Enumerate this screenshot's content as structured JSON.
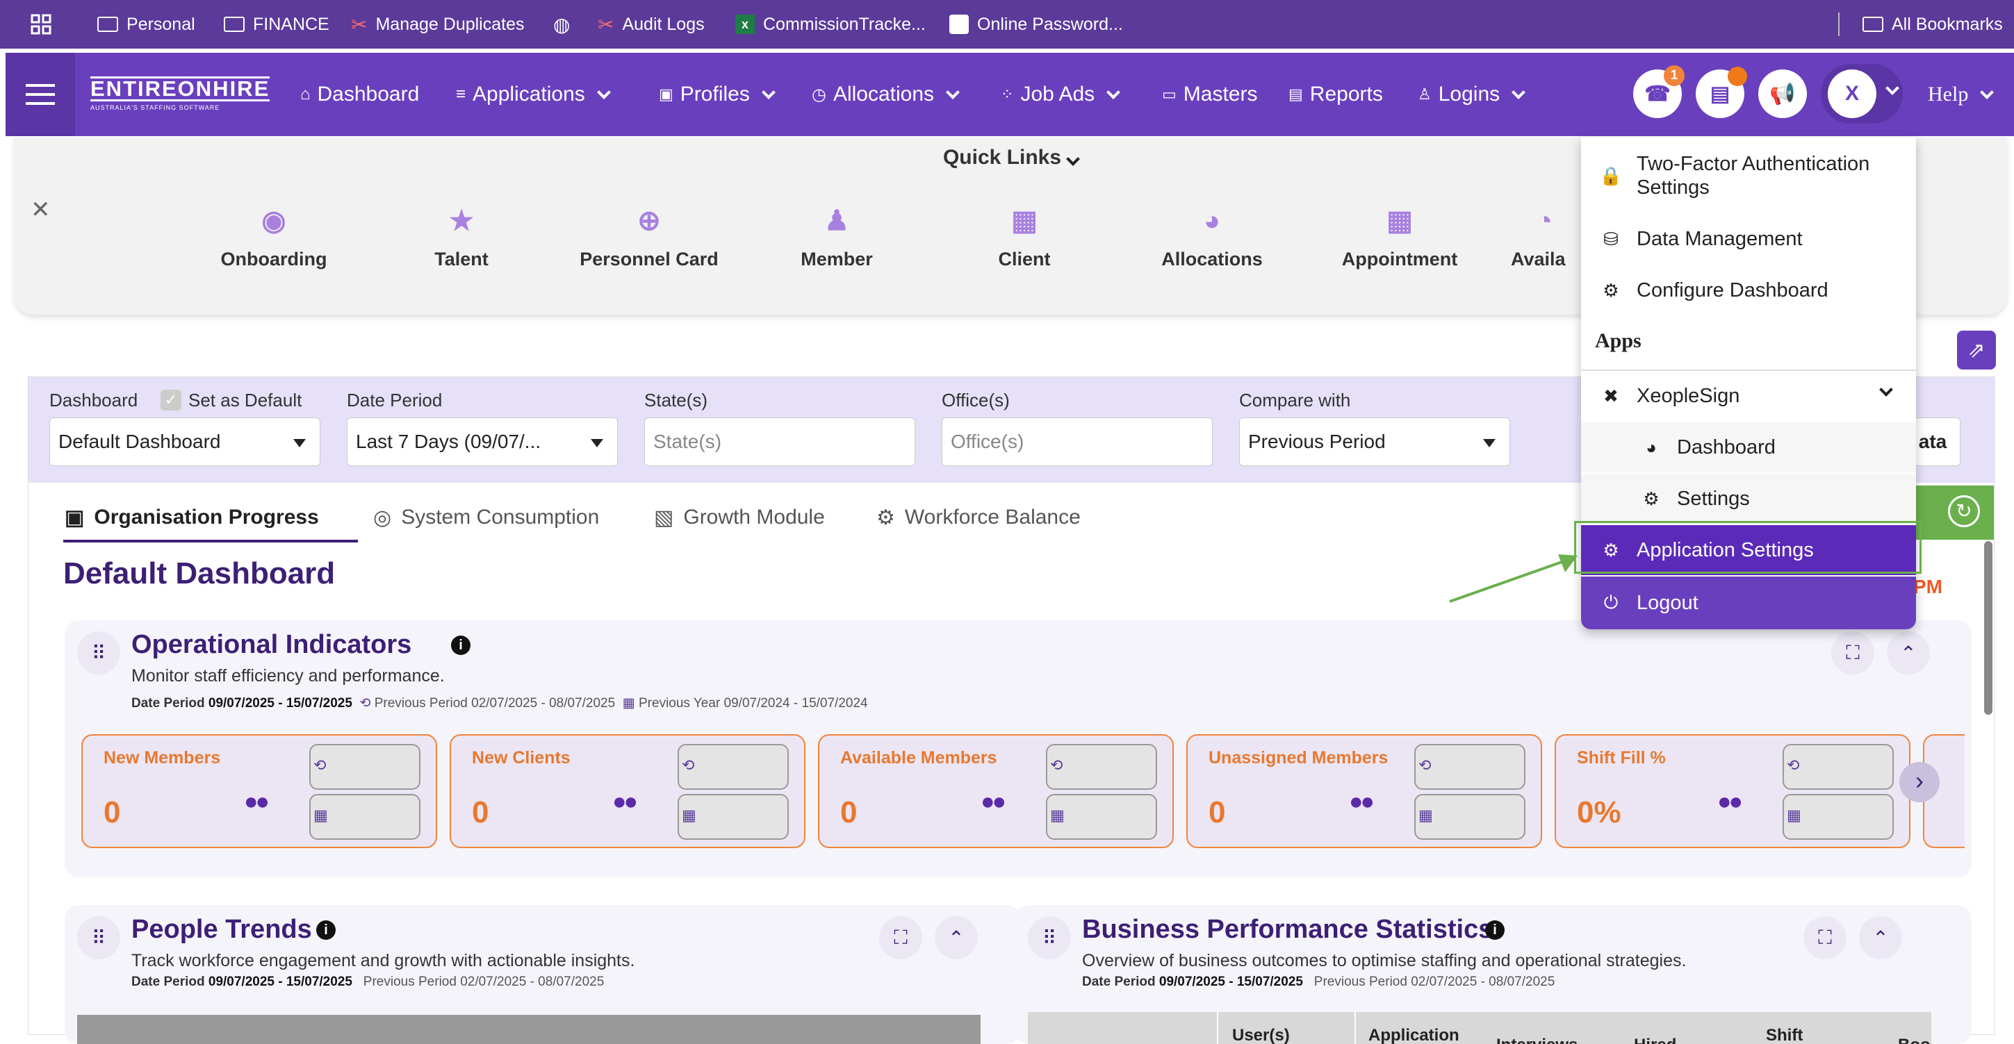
{
  "bookmarks": {
    "items": [
      {
        "label": "Personal",
        "icon": "folder-icon"
      },
      {
        "label": "FINANCE",
        "icon": "folder-icon"
      },
      {
        "label": "Manage Duplicates",
        "icon": "scissors-icon"
      },
      {
        "label": "",
        "icon": "globe-icon"
      },
      {
        "label": "Audit Logs",
        "icon": "scissors-icon"
      },
      {
        "label": "CommissionTracke...",
        "icon": "excel-icon"
      },
      {
        "label": "Online Password...",
        "icon": "password-icon"
      }
    ],
    "all_bookmarks": "All Bookmarks"
  },
  "nav": {
    "logo": "ENTIREONHIRE",
    "logo_tagline": "AUSTRALIA'S STAFFING SOFTWARE",
    "items": [
      {
        "label": "Dashboard",
        "dropdown": false
      },
      {
        "label": "Applications",
        "dropdown": true
      },
      {
        "label": "Profiles",
        "dropdown": true
      },
      {
        "label": "Allocations",
        "dropdown": true
      },
      {
        "label": "Job Ads",
        "dropdown": true
      },
      {
        "label": "Masters",
        "dropdown": false
      },
      {
        "label": "Reports",
        "dropdown": false
      },
      {
        "label": "Logins",
        "dropdown": true
      }
    ],
    "phone_badge": "1",
    "avatar_letter": "X",
    "help": "Help"
  },
  "quick_links": {
    "title": "Quick Links",
    "items": [
      "Onboarding",
      "Talent",
      "Personnel Card",
      "Member",
      "Client",
      "Allocations",
      "Appointment",
      "Availa"
    ]
  },
  "filters": {
    "dashboard_label": "Dashboard",
    "set_default_label": "Set as Default",
    "dashboard_value": "Default Dashboard",
    "date_period_label": "Date Period",
    "date_period_value": "Last 7 Days (09/07/...",
    "states_label": "State(s)",
    "states_placeholder": "State(s)",
    "offices_label": "Office(s)",
    "offices_placeholder": "Office(s)",
    "compare_label": "Compare with",
    "compare_value": "Previous Period",
    "partial_button": "ata"
  },
  "tabs": [
    "Organisation Progress",
    "System Consumption",
    "Growth Module",
    "Workforce Balance"
  ],
  "dashboard_title": "Default Dashboard",
  "time_partial": "PM",
  "operational": {
    "title": "Operational Indicators",
    "subtitle": "Monitor staff efficiency and performance.",
    "date_label": "Date Period",
    "date_value": "09/07/2025 - 15/07/2025",
    "prev_label": "Previous Period",
    "prev_value": "02/07/2025 - 08/07/2025",
    "year_label": "Previous Year",
    "year_value": "09/07/2024 - 15/07/2024",
    "kpis": [
      {
        "title": "New Members",
        "value": "0"
      },
      {
        "title": "New Clients",
        "value": "0"
      },
      {
        "title": "Available Members",
        "value": "0"
      },
      {
        "title": "Unassigned Members",
        "value": "0"
      },
      {
        "title": "Shift Fill %",
        "value": "0%"
      }
    ]
  },
  "people": {
    "title": "People Trends",
    "subtitle": "Track workforce engagement and growth with actionable insights.",
    "date_label": "Date Period",
    "date_value": "09/07/2025 - 15/07/2025",
    "prev_label": "Previous Period",
    "prev_value": "02/07/2025 - 08/07/2025"
  },
  "business": {
    "title": "Business Performance Statistics",
    "subtitle": "Overview of business outcomes to optimise staffing and operational strategies.",
    "date_label": "Date Period",
    "date_value": "09/07/2025 - 15/07/2025",
    "prev_label": "Previous Period",
    "prev_value": "02/07/2025 - 08/07/2025",
    "table_headers": [
      "User(s)",
      "Application",
      "Interviews",
      "Hired",
      "Shift",
      "Bookings"
    ]
  },
  "menu": {
    "items": [
      {
        "label": "Two-Factor Authentication Settings",
        "icon": "lock-icon"
      },
      {
        "label": "Data Management",
        "icon": "database-icon"
      },
      {
        "label": "Configure Dashboard",
        "icon": "gears-icon"
      }
    ],
    "apps_heading": "Apps",
    "xeoplesign": "XeopleSign",
    "sub_items": [
      {
        "label": "Dashboard",
        "icon": "dashboard-icon"
      },
      {
        "label": "Settings",
        "icon": "gears-icon"
      }
    ],
    "app_settings": "Application Settings",
    "logout": "Logout"
  },
  "colors": {
    "brand": "#6a3fbe",
    "accent": "#e8782e",
    "highlight": "#6ab04c"
  }
}
